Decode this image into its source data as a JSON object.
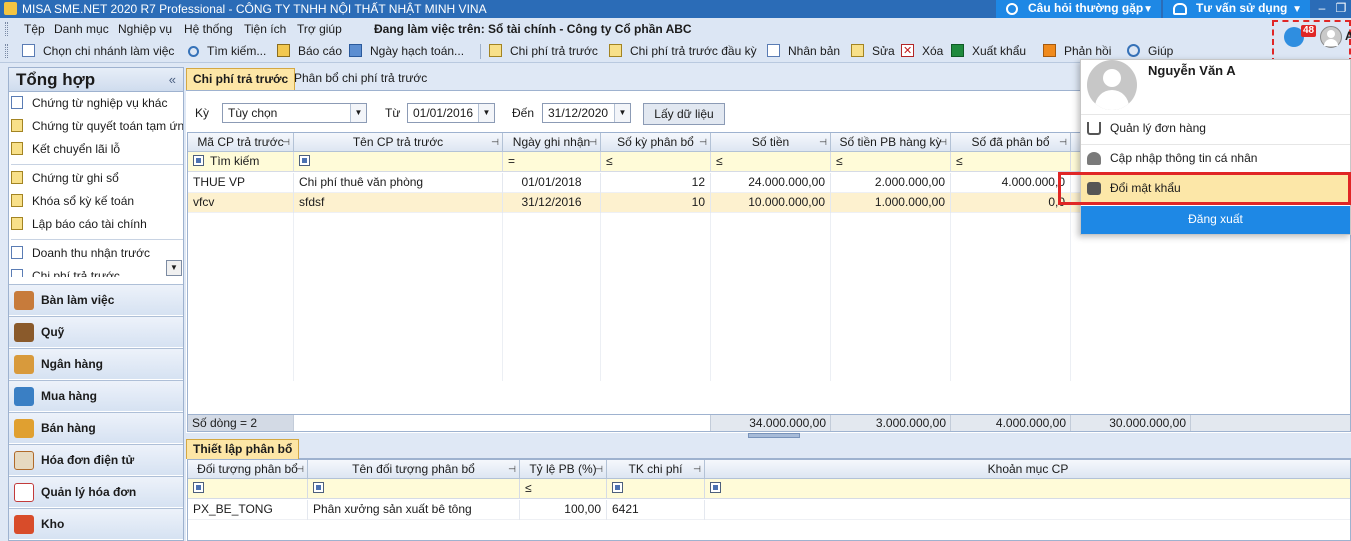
{
  "window": {
    "title": "MISA SME.NET 2020 R7 Professional - CÔNG TY TNHH NỘI THẤT NHẬT MINH VINA",
    "help_button": "Câu hỏi thường gặp",
    "consult_button": "Tư vấn sử dụng",
    "minimize": "–",
    "restore": "❐"
  },
  "menu": {
    "items": [
      "Tệp",
      "Danh mục",
      "Nghiệp vụ",
      "Hệ thống",
      "Tiện ích",
      "Trợ giúp"
    ],
    "context": "Đang làm việc trên: Sổ tài chính - Công ty Cổ phần ABC"
  },
  "toolbar": {
    "branch": "Chọn chi nhánh làm việc",
    "search": "Tìm kiếm...",
    "report": "Báo cáo",
    "posting_date": "Ngày hạch toán...",
    "prepaid": "Chi phí trả trước",
    "prepaid_opening": "Chi phí trả trước đầu kỳ",
    "duplicate": "Nhân bản",
    "edit": "Sửa",
    "delete": "Xóa",
    "export": "Xuất khẩu",
    "feedback": "Phản hồi",
    "help": "Giúp"
  },
  "notification": {
    "count": "48",
    "initial": "A"
  },
  "leftnav": {
    "title": "Tổng hợp",
    "collapse": "«",
    "subitems": [
      "Chứng từ nghiệp vụ khác",
      "Chứng từ quyết toán tạm ứn...",
      "Kết chuyển lãi lỗ",
      "Chứng từ ghi sổ",
      "Khóa sổ kỳ kế toán",
      "Lập báo cáo tài chính",
      "Doanh thu nhận trước",
      "Chi phí trả trước"
    ],
    "modules": [
      "Bàn làm việc",
      "Quỹ",
      "Ngân hàng",
      "Mua hàng",
      "Bán hàng",
      "Hóa đơn điện tử",
      "Quản lý hóa đơn",
      "Kho"
    ]
  },
  "tabs": {
    "active": "Chi phí trả trước",
    "other": "Phân bổ chi phí trả trước"
  },
  "filters": {
    "period_label": "Kỳ",
    "period_value": "Tùy chọn",
    "from_label": "Từ",
    "from_value": "01/01/2016",
    "to_label": "Đến",
    "to_value": "31/12/2020",
    "fetch_button": "Lấy dữ liệu"
  },
  "grid": {
    "columns": [
      "Mã CP trả trước",
      "Tên CP trả trước",
      "Ngày ghi nhận",
      "Số kỳ phân bổ",
      "Số tiền",
      "Số tiền PB hàng kỳ",
      "Số đã phân bổ"
    ],
    "filter_row": {
      "search": "Tìm kiếm",
      "eq": "=",
      "le": "≤"
    },
    "rows": [
      [
        "THUE VP",
        "Chi phí thuê văn phòng",
        "01/01/2018",
        "12",
        "24.000.000,00",
        "2.000.000,00",
        "4.000.000,0"
      ],
      [
        "vfcv",
        "sfdsf",
        "31/12/2016",
        "10",
        "10.000.000,00",
        "1.000.000,00",
        "0,0"
      ]
    ],
    "footer": {
      "row_count": "Số dòng = 2",
      "amount": "34.000.000,00",
      "period_amount": "3.000.000,00",
      "allocated": "4.000.000,00",
      "remaining": "30.000.000,00"
    }
  },
  "alloc": {
    "tab": "Thiết lập phân bổ",
    "columns": [
      "Đối tượng phân bổ",
      "Tên đối tượng phân bổ",
      "Tỷ lệ PB (%)",
      "TK chi phí",
      "Khoản mục CP"
    ],
    "le": "≤",
    "row": [
      "PX_BE_TONG",
      "Phân xưởng sản xuất bê tông",
      "100,00",
      "6421",
      ""
    ]
  },
  "popup": {
    "name": "Nguyễn Văn A",
    "items": [
      "Quản lý đơn hàng",
      "Cập nhập thông tin cá nhân",
      "Đổi mật khẩu"
    ],
    "logout": "Đăng xuất"
  }
}
